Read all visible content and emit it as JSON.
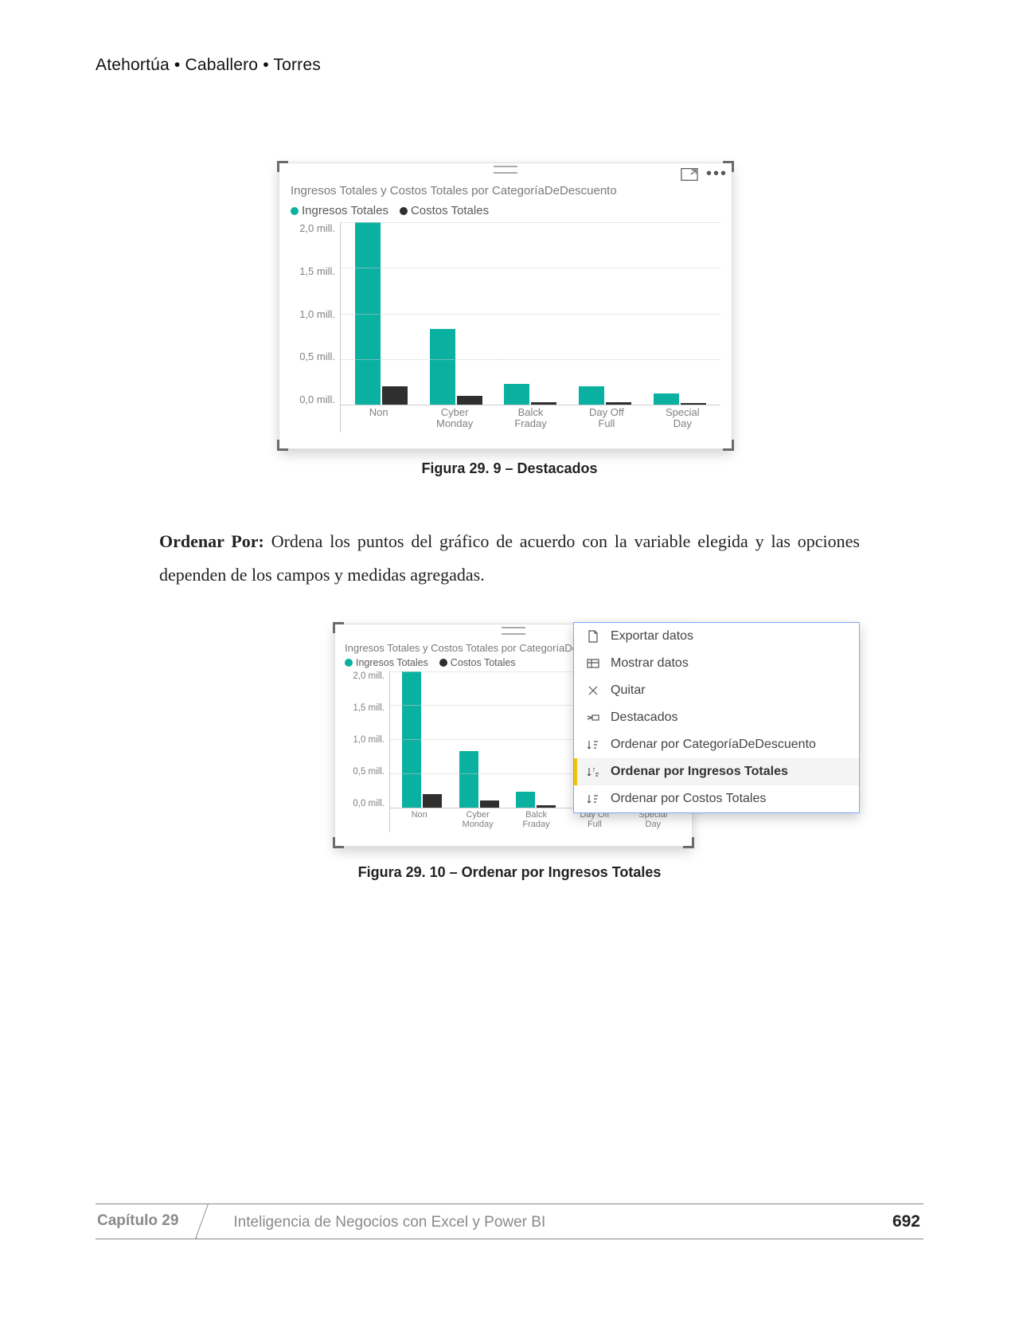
{
  "header": {
    "running": "Atehortúa • Caballero • Torres"
  },
  "figure1": {
    "caption": "Figura 29. 9 – Destacados",
    "visual_title": "Ingresos Totales y Costos Totales por CategoríaDeDescuento",
    "legend": {
      "s1": "Ingresos Totales",
      "s2": "Costos Totales"
    }
  },
  "figure2": {
    "caption": "Figura 29. 10 – Ordenar por Ingresos Totales",
    "visual_title": "Ingresos Totales y Costos Totales por CategoríaDeDescuento",
    "legend": {
      "s1": "Ingresos Totales",
      "s2": "Costos Totales"
    }
  },
  "paragraph": {
    "label": "Ordenar Por:",
    "text": " Ordena los puntos del gráfico de acuerdo con la variable elegida y las opciones dependen de los campos y medidas agregadas."
  },
  "context_menu": {
    "export": "Exportar datos",
    "show": "Mostrar datos",
    "remove": "Quitar",
    "spotlight": "Destacados",
    "sort_cat": "Ordenar por CategoríaDeDescuento",
    "sort_ing": "Ordenar por Ingresos Totales",
    "sort_cos": "Ordenar por Costos Totales"
  },
  "footer": {
    "chapter": "Capítulo 29",
    "title": "Inteligencia de Negocios con Excel y Power BI",
    "page": "692"
  },
  "chart_data": {
    "type": "bar",
    "title": "Ingresos Totales y Costos Totales por CategoríaDeDescuento",
    "ylabel": "",
    "xlabel": "",
    "ylim": [
      0,
      2.0
    ],
    "y_ticks": [
      "2,0 mill.",
      "1,5 mill.",
      "1,0 mill.",
      "0,5 mill.",
      "0,0 mill."
    ],
    "categories": [
      "Non",
      "Cyber Monday",
      "Balck Fraday",
      "Day Off Full",
      "Special Day"
    ],
    "category_labels": [
      "Non",
      "Cyber\nMonday",
      "Balck\nFraday",
      "Day Off\nFull",
      "Special\nDay"
    ],
    "series": [
      {
        "name": "Ingresos Totales",
        "color": "#0bb1a0",
        "values": [
          2.0,
          0.83,
          0.23,
          0.2,
          0.12
        ]
      },
      {
        "name": "Costos Totales",
        "color": "#2f2f2f",
        "values": [
          0.2,
          0.1,
          0.03,
          0.03,
          0.02
        ]
      }
    ]
  }
}
